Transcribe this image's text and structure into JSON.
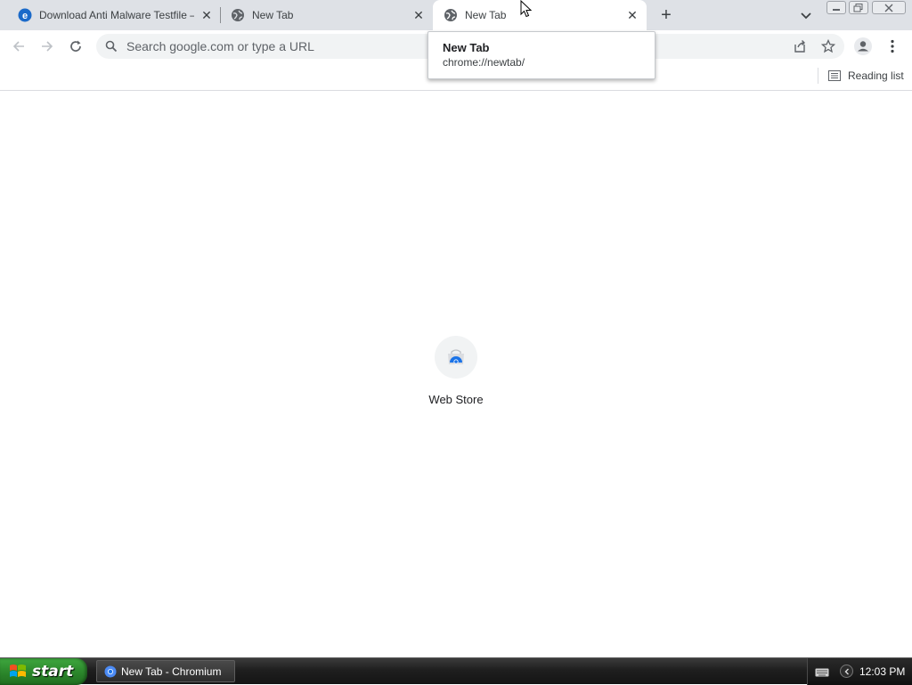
{
  "tabs": [
    {
      "title": "Download Anti Malware Testfile – Ei",
      "icon": "edge-icon",
      "active": false
    },
    {
      "title": "New Tab",
      "icon": "globe-icon",
      "active": false
    },
    {
      "title": "New Tab",
      "icon": "globe-icon",
      "active": true
    }
  ],
  "tooltip": {
    "title": "New Tab",
    "url": "chrome://newtab/"
  },
  "omnibox": {
    "placeholder": "Search google.com or type a URL",
    "value": ""
  },
  "bookmarks": {
    "reading_list_label": "Reading list"
  },
  "shortcuts": [
    {
      "label": "Web Store",
      "icon": "web-store-icon"
    }
  ],
  "taskbar": {
    "start_label": "start",
    "items": [
      {
        "label": "New Tab - Chromium",
        "icon": "chromium-icon"
      }
    ],
    "clock": "12:03 PM"
  },
  "colors": {
    "tab_strip": "#dee1e6",
    "active_tab": "#ffffff",
    "omnibox_bg": "#f1f3f4",
    "start_green": "#2e8b2e",
    "accent_blue": "#1a73e8"
  }
}
